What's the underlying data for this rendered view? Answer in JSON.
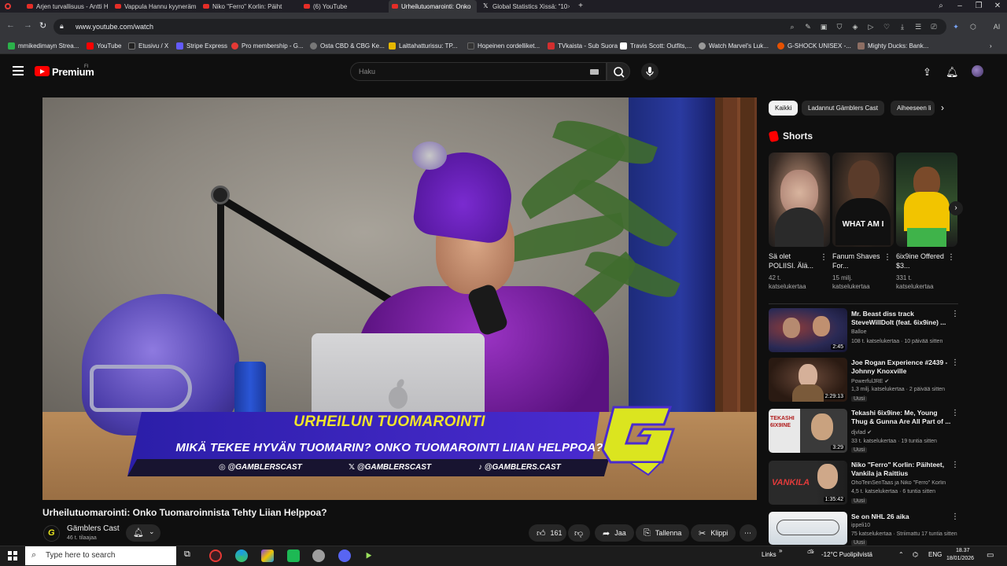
{
  "browser": {
    "tabs": [
      {
        "label": "Arjen turvallisuus - Antti H",
        "active": false
      },
      {
        "label": "Vappula Hannu kyynerämi",
        "active": false
      },
      {
        "label": "Niko \"Ferro\" Korlin: Päiht",
        "active": false
      },
      {
        "label": "(6) YouTube",
        "active": false
      },
      {
        "label": "Urheilutuomarointi: Onko",
        "active": true
      },
      {
        "label": "Global Statistics Xissä: \"10",
        "active": false
      }
    ],
    "new_tab": "+",
    "url": "www.youtube.com/watch",
    "bookmarks": [
      {
        "label": "mmikedimayn Strea...",
        "color": "#2bb14a"
      },
      {
        "label": "YouTube",
        "color": "#ff0000"
      },
      {
        "label": "Etusivu / X",
        "color": "#222222"
      },
      {
        "label": "Stripe Express",
        "color": "#635bff"
      },
      {
        "label": "Pro membership - G...",
        "color": "#e53935"
      },
      {
        "label": "Osta CBD & CBG Ke...",
        "color": "#777777"
      },
      {
        "label": "Laittahatturissu: TP...",
        "color": "#e6b800"
      },
      {
        "label": "Hopeinen cordelliket...",
        "color": "#333333"
      },
      {
        "label": "TVkaista - Sub Suora",
        "color": "#d32f2f"
      },
      {
        "label": "Travis Scott: Outfits,...",
        "color": "#ffffff"
      },
      {
        "label": "Watch Marvel's Luk...",
        "color": "#999999"
      },
      {
        "label": "G-SHOCK UNISEX -...",
        "color": "#e65100"
      },
      {
        "label": "Mighty Ducks: Bank...",
        "color": "#8d6e63"
      }
    ]
  },
  "youtube": {
    "brand": "Premium",
    "region": "FI",
    "search_placeholder": "Haku",
    "video": {
      "banner_title": "URHEILUN TUOMAROINTI",
      "banner_subtitle": "MIKÄ TEKEE HYVÄN TUOMARIN? ONKO TUOMAROINTI LIIAN HELPPOA?",
      "social_instagram": "@GAMBLERSCAST",
      "social_x": "@GAMBLERSCAST",
      "social_tiktok": "@GAMBLERS.CAST",
      "title": "Urheilutuomarointi: Onko Tuomaroinnista Tehty Liian Helppoa?",
      "channel": "Gämblers Cast",
      "subscribers": "46 t. tilaajaa",
      "likes": "161",
      "share": "Jaa",
      "save": "Tallenna",
      "clip": "Klippi"
    },
    "chips": [
      "Kaikki",
      "Ladannut Gämblers Cast",
      "Aiheeseen li"
    ],
    "shorts_heading": "Shorts",
    "shorts": [
      {
        "title": "Sä olet POLIISI. Älä...",
        "views": "42 t. katselukertaa"
      },
      {
        "title": "Fanum Shaves For...",
        "views": "15 milj. katselukertaa"
      },
      {
        "title": "6ix9ine Offered $3...",
        "views": "331 t. katselukertaa"
      }
    ],
    "shorts_overlay_text": "WHAT AM I",
    "recommendations": [
      {
        "title": "Mr. Beast diss track SteveWillDoIt (feat. 6ix9ine) ...",
        "channel": "Balloe",
        "meta": "108 t. katselukertaa · 10 päivää sitten",
        "duration": "2:45",
        "badge": ""
      },
      {
        "title": "Joe Rogan Experience #2439 - Johnny Knoxville",
        "channel": "PowerfulJRE ✔",
        "meta": "1,3 milj. katselukertaa · 2 päivää sitten",
        "duration": "2:29:13",
        "badge": "Uusi"
      },
      {
        "title": "Tekashi 6ix9ine: Me, Young Thug & Gunna Are All Part of ...",
        "channel": "djvlad ✔",
        "meta": "33 t. katselukertaa · 19 tuntia sitten",
        "duration": "3:29",
        "badge": "Uusi"
      },
      {
        "title": "Niko \"Ferro\" Korlin: Päihteet, Vankila ja Raittius",
        "channel": "OhoTeinSenTaas ja Niko \"Ferro\" Korlin",
        "meta": "4,5 t. katselukertaa · 6 tuntia sitten",
        "duration": "1:35:42",
        "badge": "Uusi"
      },
      {
        "title": "Se on NHL 26 aika",
        "channel": "ippeli10",
        "meta": "75 katselukertaa · Striimattu 17 tuntia sitten",
        "duration": "",
        "badge": "Uusi"
      }
    ],
    "rec_thumb_texts": [
      "TEKASHI 6IX9INE",
      "VANKILA"
    ]
  },
  "taskbar": {
    "search_placeholder": "Type here to search",
    "links": "Links",
    "weather": "-12°C  Puolipilvistä",
    "lang": "ENG",
    "time": "18.37",
    "date": "18/01/2026"
  }
}
